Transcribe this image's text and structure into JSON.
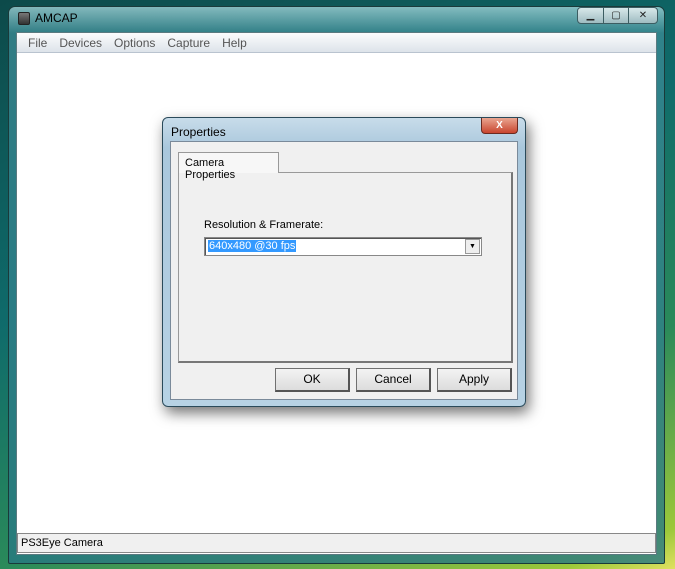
{
  "window": {
    "title": "AMCAP",
    "controls": [
      "minimize",
      "maximize",
      "close"
    ]
  },
  "menu": [
    "File",
    "Devices",
    "Options",
    "Capture",
    "Help"
  ],
  "status_bar": {
    "text": "PS3Eye Camera"
  },
  "dialog": {
    "title": "Properties",
    "tab": "Camera Properties",
    "resolution_label": "Resolution & Framerate:",
    "resolution_value": "640x480 @30 fps",
    "buttons": {
      "ok": "OK",
      "cancel": "Cancel",
      "apply": "Apply"
    }
  }
}
